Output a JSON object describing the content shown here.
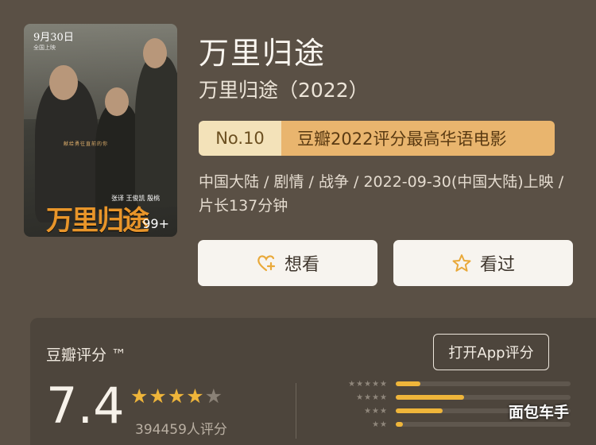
{
  "poster": {
    "date_line1": "9月30日",
    "date_line2": "全国上映",
    "logo_text": "万里归途",
    "tagline": "献给勇往直前的你",
    "cast": "张译  王俊凯  殷桃",
    "badge": "99+"
  },
  "movie": {
    "title": "万里归途",
    "subtitle": "万里归途（2022）",
    "rank_no": "No.10",
    "rank_label": "豆瓣2022评分最高华语电影",
    "meta": "中国大陆 / 剧情 / 战争 / 2022-09-30(中国大陆)上映 / 片长137分钟"
  },
  "actions": {
    "want_label": "想看",
    "seen_label": "看过"
  },
  "rating": {
    "label": "豆瓣评分 ™",
    "app_button": "打开App评分",
    "score": "7.4",
    "stars_on": "★★★★",
    "stars_off": "★",
    "votes": "394459人评分",
    "distribution": [
      {
        "stars": "★★★★★",
        "fraction": 0.14
      },
      {
        "stars": "★★★★",
        "fraction": 0.39
      },
      {
        "stars": "★★★",
        "fraction": 0.27
      },
      {
        "stars": "★★",
        "fraction": 0.04
      }
    ]
  },
  "watermark": "面包车手",
  "colors": {
    "accent": "#efb53a",
    "rank_bg": "#e9b56e",
    "background": "#5a5045"
  },
  "icons": {
    "want": "heart-plus-icon",
    "seen": "star-outline-icon"
  }
}
